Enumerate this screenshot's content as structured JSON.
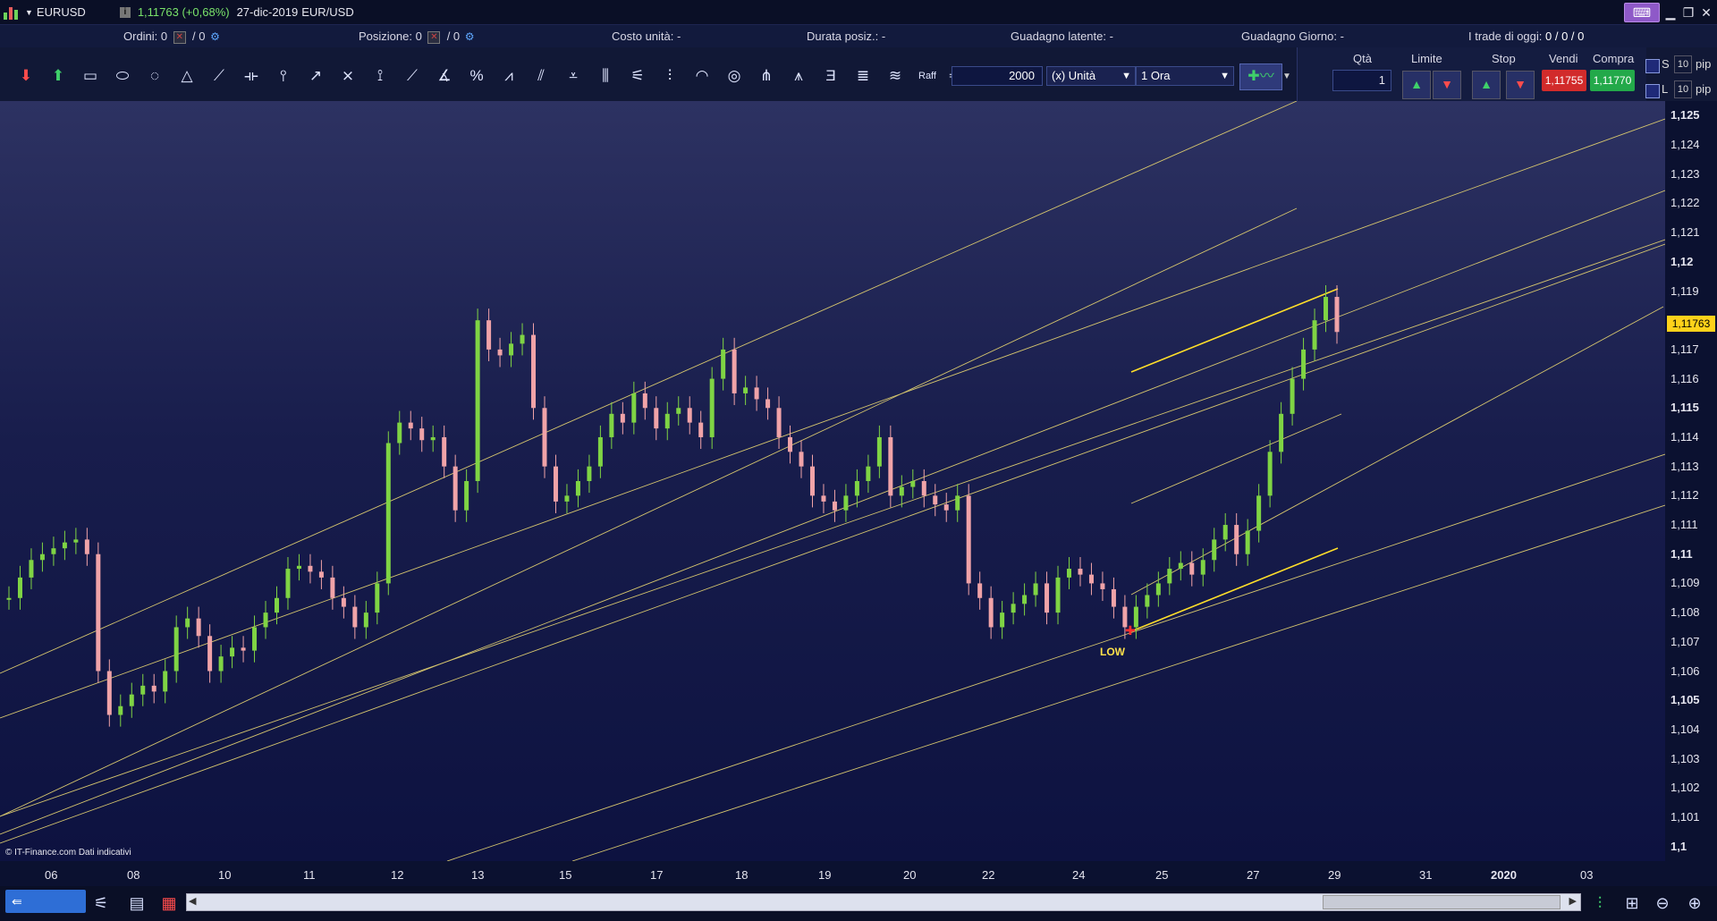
{
  "titlebar": {
    "symbol": "EURUSD",
    "quote": "1,11763 (+0,68%)",
    "date": "27-dic-2019",
    "pair": "EUR/USD"
  },
  "infobar": {
    "orders_label": "Ordini:",
    "orders_value": "0",
    "orders_slash": "/ 0",
    "position_label": "Posizione:",
    "position_value": "0",
    "position_slash": "/ 0",
    "unit_cost": "Costo unità: -",
    "duration": "Durata posiz.: -",
    "unrealized": "Guadagno latente: -",
    "daily_gain": "Guadagno Giorno: -",
    "trades_today_label": "I trade di oggi:",
    "trades_today_value": "0 / 0 / 0"
  },
  "toolbar": {
    "quantity": "2000",
    "unit_select": "(x) Unità",
    "timeframe_select": "1 Ora",
    "tools": [
      "arrow-down-icon",
      "arrow-up-icon",
      "rectangle-icon",
      "ellipse-icon",
      "circle-icon",
      "triangle-icon",
      "trendline-icon",
      "hline-icon",
      "vline-icon",
      "ray-icon",
      "crosshair-icon",
      "span-icon",
      "fan-icon",
      "angle-icon",
      "percent-icon",
      "zigzag-icon",
      "channel-icon",
      "regression-icon",
      "gann-icon",
      "fib-fan-icon",
      "fib-time-icon",
      "arc-icon",
      "spiral-icon",
      "pitchfork-icon",
      "schiff-icon",
      "text-icon",
      "fib-retracement-icon",
      "fib-extension-icon",
      "raff-icon",
      "speed-lines-icon",
      "trash-icon",
      "rainbow-icon"
    ],
    "raff_label": "Raff"
  },
  "order_panel": {
    "qty_label": "Qtà",
    "qty_value": "1",
    "limit_label": "Limite",
    "stop_label": "Stop",
    "sell_label": "Vendi",
    "buy_label": "Compra",
    "sell_price": "1,11755",
    "buy_price": "1,11770",
    "s_label": "S",
    "l_label": "L",
    "pip_value": "10",
    "pip_unit": "pip"
  },
  "chart": {
    "current_price": "1,11763",
    "low_label": "LOW",
    "credit": "© IT-Finance.com  Dati indicativi",
    "colors": {
      "up": "#7fd444",
      "down": "#f0a3a8",
      "line": "#d6c66e",
      "hl": "#ffdf2a",
      "marker": "#ff3030"
    }
  },
  "chart_data": {
    "type": "line",
    "title": "",
    "xlabel": "",
    "ylabel": "",
    "x_ticks": [
      "06",
      "08",
      "10",
      "11",
      "12",
      "13",
      "15",
      "17",
      "18",
      "19",
      "20",
      "22",
      "24",
      "25",
      "27",
      "29",
      "31",
      "2020",
      "03"
    ],
    "y_ticks": [
      "1,125",
      "1,124",
      "1,123",
      "1,122",
      "1,121",
      "1,12",
      "1,119",
      "1,118",
      "1,117",
      "1,116",
      "1,115",
      "1,114",
      "1,113",
      "1,112",
      "1,111",
      "1,11",
      "1,109",
      "1,108",
      "1,107",
      "1,106",
      "1,105",
      "1,104",
      "1,103",
      "1,102",
      "1,101",
      "1,1"
    ],
    "y_bold": [
      "1,125",
      "1,12",
      "1,115",
      "1,11",
      "1,105",
      "1,1"
    ],
    "ylim": [
      1.0995,
      1.1255
    ],
    "series": [
      {
        "values": [
          1.1085,
          1.1092,
          1.1098,
          1.11,
          1.1102,
          1.1104,
          1.1105,
          1.11,
          1.106,
          1.1045,
          1.1048,
          1.1052,
          1.1055,
          1.1053,
          1.106,
          1.1075,
          1.1078,
          1.1072,
          1.106,
          1.1065,
          1.1068,
          1.1067,
          1.1075,
          1.108,
          1.1085,
          1.1095,
          1.1096,
          1.1094,
          1.1092,
          1.1085,
          1.1082,
          1.1075,
          1.108,
          1.109,
          1.1138,
          1.1145,
          1.1143,
          1.1139,
          1.114,
          1.113,
          1.1115,
          1.1125,
          1.118,
          1.117,
          1.1168,
          1.1172,
          1.1175,
          1.115,
          1.113,
          1.1118,
          1.112,
          1.1125,
          1.113,
          1.114,
          1.1148,
          1.1145,
          1.1155,
          1.115,
          1.1143,
          1.1148,
          1.115,
          1.1145,
          1.114,
          1.116,
          1.117,
          1.1155,
          1.1157,
          1.1153,
          1.115,
          1.114,
          1.1135,
          1.113,
          1.112,
          1.1118,
          1.1115,
          1.112,
          1.1125,
          1.113,
          1.114,
          1.112,
          1.1123,
          1.1125,
          1.112,
          1.1117,
          1.1115,
          1.112,
          1.109,
          1.1085,
          1.1075,
          1.108,
          1.1083,
          1.1086,
          1.109,
          1.108,
          1.1092,
          1.1095,
          1.1093,
          1.109,
          1.1088,
          1.1082,
          1.1075,
          1.1082,
          1.1086,
          1.109,
          1.1095,
          1.1097,
          1.1093,
          1.1098,
          1.1105,
          1.111,
          1.11,
          1.1108,
          1.112,
          1.1135,
          1.1148,
          1.116,
          1.117,
          1.118,
          1.1188,
          1.1176
        ]
      }
    ]
  }
}
